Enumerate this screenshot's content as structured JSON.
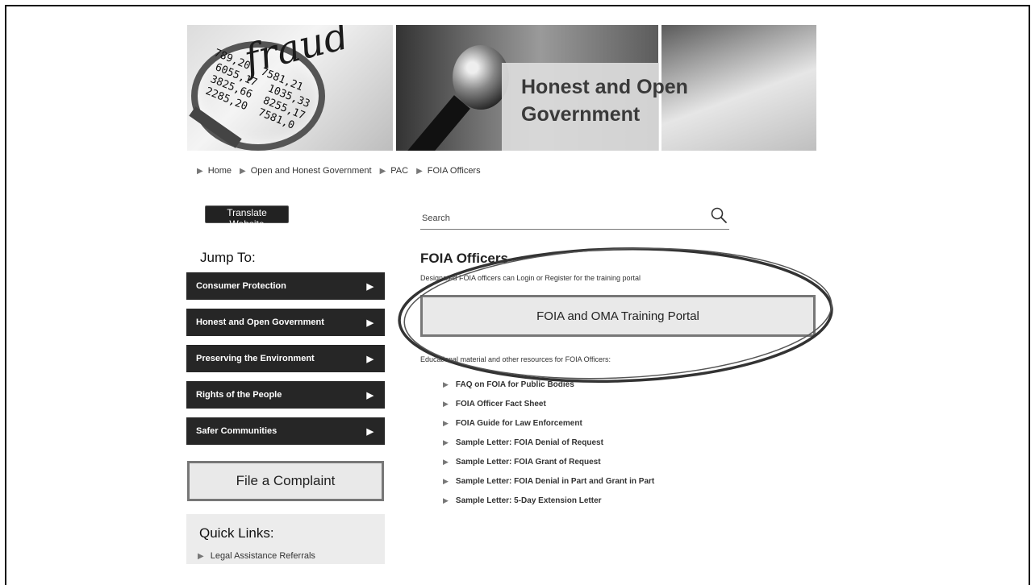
{
  "banner": {
    "title": "Honest and Open Government",
    "image_text": "fraud"
  },
  "breadcrumb": [
    "Home",
    "Open and Honest Government",
    "PAC",
    "FOIA Officers"
  ],
  "translate_label": "Translate Website",
  "jump_to": {
    "title": "Jump To:",
    "items": [
      "Consumer Protection",
      "Honest and Open Government",
      "Preserving the Environment",
      "Rights of the People",
      "Safer Communities"
    ]
  },
  "complaint_label": "File a Complaint",
  "quick_links": {
    "title": "Quick Links:",
    "items": [
      "Legal Assistance Referrals"
    ]
  },
  "search": {
    "placeholder": "Search",
    "icon": "search-icon"
  },
  "main": {
    "title": "FOIA Officers",
    "description": "Designated FOIA officers can Login or Register for the training portal",
    "portal_label": "FOIA and OMA Training Portal",
    "resources_intro": "Educational material and other resources for FOIA Officers:",
    "resources": [
      "FAQ on FOIA for Public Bodies",
      "FOIA Officer Fact Sheet",
      "FOIA Guide for Law Enforcement",
      "Sample Letter: FOIA Denial of Request",
      "Sample Letter: FOIA Grant of Request",
      "Sample Letter: FOIA Denial in Part and Grant in Part",
      "Sample Letter: 5-Day Extension Letter"
    ]
  },
  "colors": {
    "nav_bg": "#262626",
    "button_bg": "#e9e9e9",
    "button_border": "#777777"
  }
}
